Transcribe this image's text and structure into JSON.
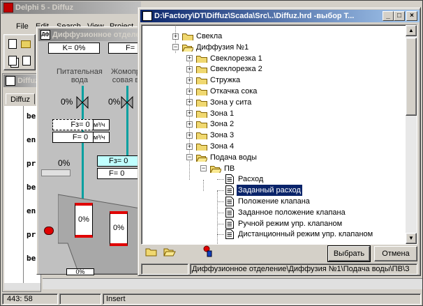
{
  "ide": {
    "title": "Delphi 5 - Diffuz",
    "menu": [
      "File",
      "Edit",
      "Search",
      "View",
      "Project"
    ],
    "editor_title": "Diffuz",
    "editor_tab": "Diffuz",
    "code_lines": [
      "be",
      "en",
      "pr",
      "be",
      "en",
      "pr",
      "be"
    ],
    "status_pos": "443: 58",
    "status_mode": "Insert"
  },
  "diagram": {
    "title": "Диффузионное отделе",
    "k_label": "K= 0%",
    "f_label": "F=",
    "label_feed": [
      "Питательная",
      "вода"
    ],
    "label_press": [
      "Жомопр",
      "совая в"
    ],
    "valve1_pct": "0%",
    "valve2_pct": "0%",
    "fz1_label": "Fз= 0",
    "fz1_unit": "м³/ч",
    "f1_label": "F= 0",
    "f1_unit": "м³/ч",
    "fz2_label": "Fз= 0",
    "f2_label": "F= 0",
    "pct_small": "0%",
    "tank1_pct": "0%",
    "tank2_pct": "0%",
    "bottom_pct": "0%"
  },
  "dialog": {
    "title": "D:\\Factory\\DT\\Diffuz\\Scada\\Src\\..\\Diffuz.hrd -выбор Т...",
    "tree": [
      {
        "label": "Свекла",
        "level": 0,
        "type": "folder",
        "expander": "+"
      },
      {
        "label": "Диффузия №1",
        "level": 0,
        "type": "folder-open",
        "expander": "-"
      },
      {
        "label": "Свеклорезка 1",
        "level": 1,
        "type": "folder",
        "expander": "+"
      },
      {
        "label": "Свеклорезка 2",
        "level": 1,
        "type": "folder",
        "expander": "+"
      },
      {
        "label": "Стружка",
        "level": 1,
        "type": "folder",
        "expander": "+"
      },
      {
        "label": "Откачка сока",
        "level": 1,
        "type": "folder",
        "expander": "+"
      },
      {
        "label": "Зона у сита",
        "level": 1,
        "type": "folder",
        "expander": "+"
      },
      {
        "label": "Зона 1",
        "level": 1,
        "type": "folder",
        "expander": "+"
      },
      {
        "label": "Зона 2",
        "level": 1,
        "type": "folder",
        "expander": "+"
      },
      {
        "label": "Зона 3",
        "level": 1,
        "type": "folder",
        "expander": "+"
      },
      {
        "label": "Зона 4",
        "level": 1,
        "type": "folder",
        "expander": "+"
      },
      {
        "label": "Подача воды",
        "level": 1,
        "type": "folder-open",
        "expander": "-"
      },
      {
        "label": "ПВ",
        "level": 2,
        "type": "folder-open",
        "expander": "-"
      },
      {
        "label": "Расход",
        "level": 3,
        "type": "doc",
        "expander": ""
      },
      {
        "label": "Заданный расход",
        "level": 3,
        "type": "doc",
        "expander": "",
        "selected": true
      },
      {
        "label": "Положение клапана",
        "level": 3,
        "type": "doc",
        "expander": ""
      },
      {
        "label": "Заданное положение клапана",
        "level": 3,
        "type": "doc",
        "expander": ""
      },
      {
        "label": "Ручной режим упр. клапаном",
        "level": 3,
        "type": "doc",
        "expander": ""
      },
      {
        "label": "Дистанционный режим упр. клапаном",
        "level": 3,
        "type": "doc",
        "expander": ""
      }
    ],
    "ok_label": "Выбрать",
    "cancel_label": "Отмена",
    "status_path": "Диффузионное отделение\\Диффузия №1\\Подача воды\\ПВ\\З"
  }
}
